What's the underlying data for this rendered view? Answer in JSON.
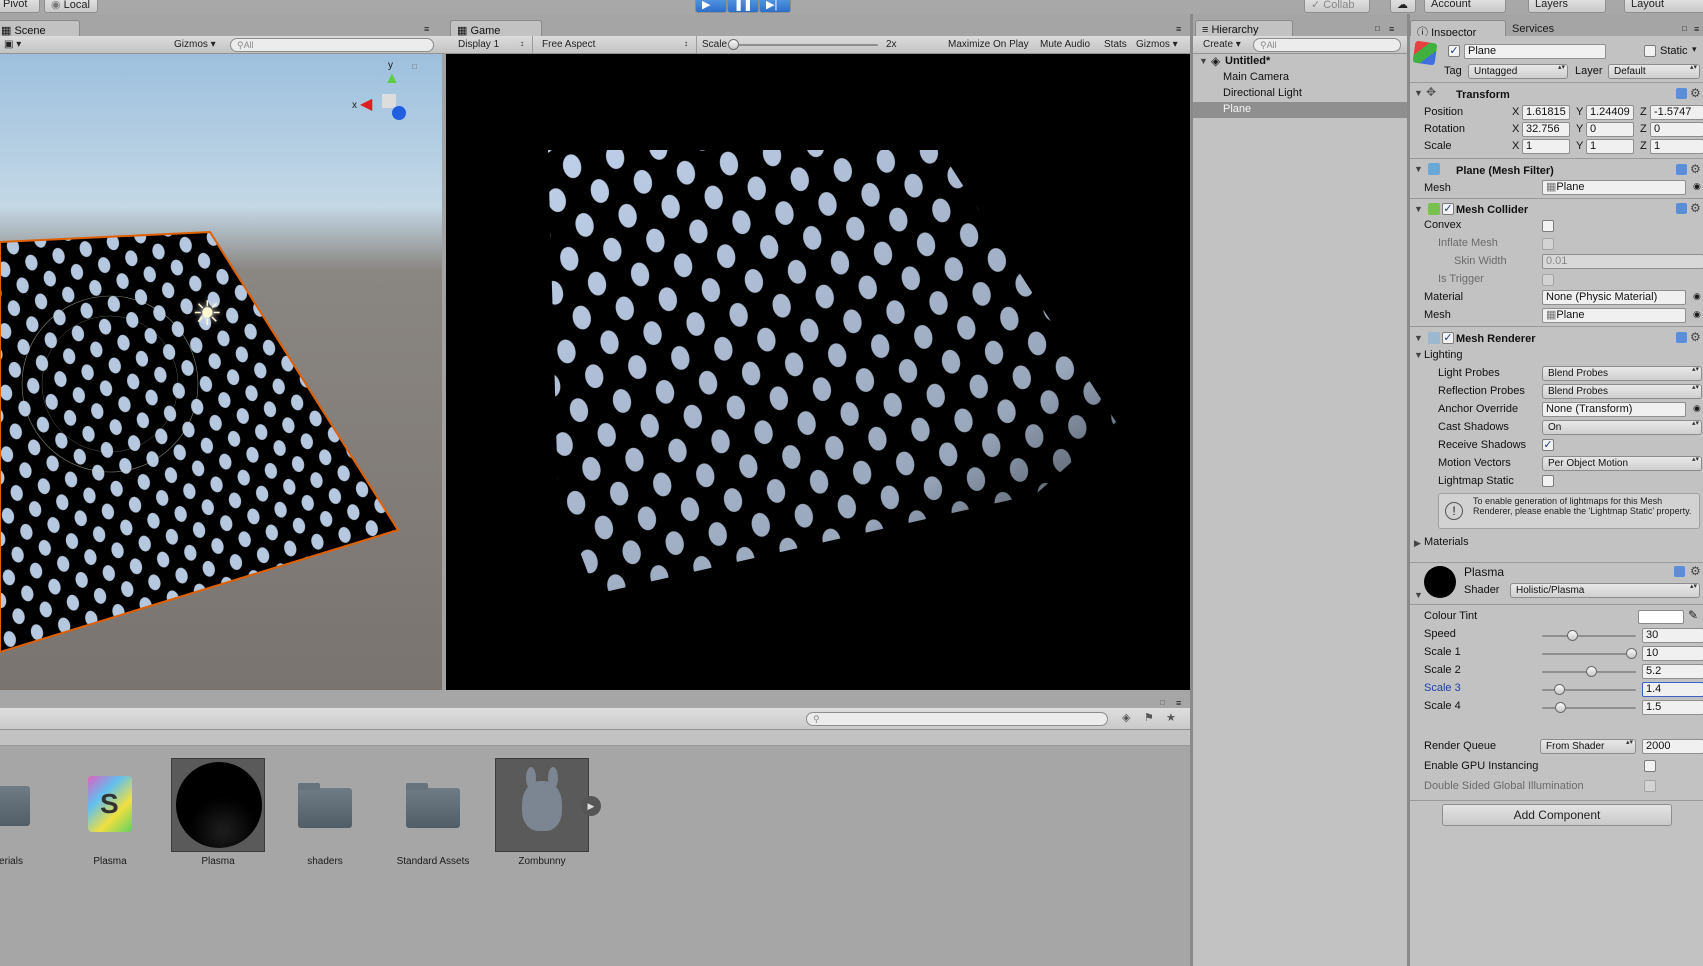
{
  "top_toolbar": {
    "pivot": "Pivot",
    "local": "Local",
    "collab": "Collab",
    "account": "Account",
    "layers": "Layers",
    "layout": "Layout"
  },
  "scene": {
    "tab": "Scene",
    "gizmos": "Gizmos",
    "search_placeholder": "All",
    "axis_y": "y",
    "axis_x": "x"
  },
  "game": {
    "tab": "Game",
    "display": "Display 1",
    "aspect": "Free Aspect",
    "scale_label": "Scale",
    "scale_value": "2x",
    "maximize": "Maximize On Play",
    "mute": "Mute Audio",
    "stats": "Stats",
    "gizmos": "Gizmos"
  },
  "hierarchy": {
    "tab": "Hierarchy",
    "create": "Create",
    "search_placeholder": "All",
    "scene_name": "Untitled*",
    "items": [
      "Main Camera",
      "Directional Light",
      "Plane"
    ]
  },
  "project": {
    "assets": [
      {
        "label": "erials"
      },
      {
        "label": "Plasma"
      },
      {
        "label": "Plasma"
      },
      {
        "label": "shaders"
      },
      {
        "label": "Standard Assets"
      },
      {
        "label": "Zombunny"
      }
    ]
  },
  "inspector": {
    "tab": "Inspector",
    "services_tab": "Services",
    "object_name": "Plane",
    "static_label": "Static",
    "tag_label": "Tag",
    "tag_value": "Untagged",
    "layer_label": "Layer",
    "layer_value": "Default",
    "transform": {
      "title": "Transform",
      "position_label": "Position",
      "rotation_label": "Rotation",
      "scale_label": "Scale",
      "x": "X",
      "y": "Y",
      "z": "Z",
      "position": [
        "1.61815",
        "1.24409",
        "-1.5747"
      ],
      "rotation": [
        "32.756",
        "0",
        "0"
      ],
      "scale": [
        "1",
        "1",
        "1"
      ]
    },
    "mesh_filter": {
      "title": "Plane (Mesh Filter)",
      "mesh_label": "Mesh",
      "mesh_value": "Plane"
    },
    "mesh_collider": {
      "title": "Mesh Collider",
      "convex": "Convex",
      "inflate": "Inflate Mesh",
      "skin": "Skin Width",
      "skin_value": "0.01",
      "trigger": "Is Trigger",
      "material_label": "Material",
      "material_value": "None (Physic Material)",
      "mesh_label": "Mesh",
      "mesh_value": "Plane"
    },
    "mesh_renderer": {
      "title": "Mesh Renderer",
      "lighting": "Lighting",
      "light_probes": "Light Probes",
      "light_probes_value": "Blend Probes",
      "reflection_probes": "Reflection Probes",
      "reflection_probes_value": "Blend Probes",
      "anchor_override": "Anchor Override",
      "anchor_override_value": "None (Transform)",
      "cast_shadows": "Cast Shadows",
      "cast_shadows_value": "On",
      "receive_shadows": "Receive Shadows",
      "motion_vectors": "Motion Vectors",
      "motion_vectors_value": "Per Object Motion",
      "lightmap_static": "Lightmap Static",
      "info": "To enable generation of lightmaps for this Mesh Renderer, please enable the 'Lightmap Static' property.",
      "materials": "Materials"
    },
    "material": {
      "name": "Plasma",
      "shader_label": "Shader",
      "shader_value": "Holistic/Plasma",
      "colour_tint": "Colour Tint",
      "sliders": [
        {
          "label": "Speed",
          "value": "30",
          "fraction": 0.3
        },
        {
          "label": "Scale 1",
          "value": "10",
          "fraction": 1.0
        },
        {
          "label": "Scale 2",
          "value": "5.2",
          "fraction": 0.52
        },
        {
          "label": "Scale 3",
          "value": "1.4",
          "fraction": 0.14
        },
        {
          "label": "Scale 4",
          "value": "1.5",
          "fraction": 0.15
        }
      ],
      "render_queue": "Render Queue",
      "render_queue_mode": "From Shader",
      "render_queue_value": "2000",
      "gpu_instancing": "Enable GPU Instancing",
      "double_sided": "Double Sided Global Illumination"
    },
    "add_component": "Add Component"
  }
}
